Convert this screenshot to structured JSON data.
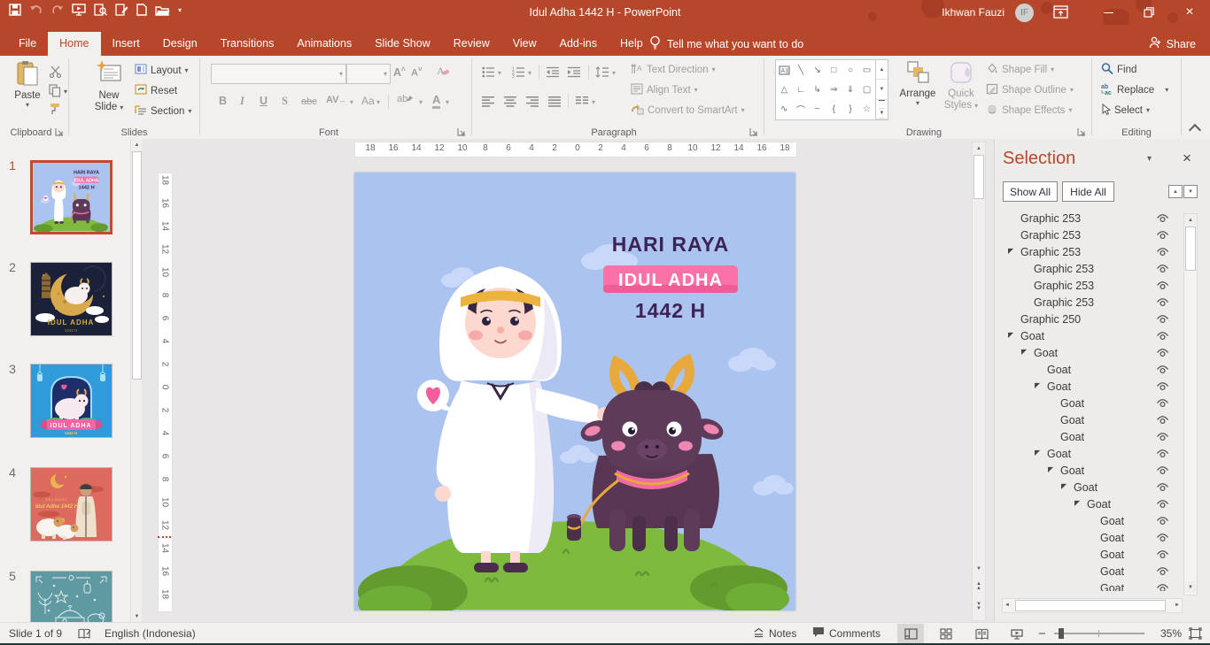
{
  "titlebar": {
    "title": "Idul Adha 1442 H  -  PowerPoint",
    "user": "Ikhwan Fauzi",
    "initials": "IF"
  },
  "tabs": {
    "items": [
      "File",
      "Home",
      "Insert",
      "Design",
      "Transitions",
      "Animations",
      "Slide Show",
      "Review",
      "View",
      "Add-ins",
      "Help"
    ],
    "active": "Home",
    "tell_me": "Tell me what you want to do",
    "share": "Share"
  },
  "ribbon": {
    "clipboard": {
      "title": "Clipboard",
      "paste": "Paste"
    },
    "slides": {
      "title": "Slides",
      "new_line1": "New",
      "new_line2": "Slide",
      "layout": "Layout",
      "reset": "Reset",
      "section": "Section"
    },
    "font": {
      "title": "Font",
      "bold": "B",
      "italic": "I",
      "underline": "U",
      "strikethrough": "S",
      "abc": "abc",
      "spacing": "AV",
      "case": "Aa",
      "highlight": "ab",
      "color": "A",
      "grow": "A",
      "shrink": "A"
    },
    "paragraph": {
      "title": "Paragraph",
      "text_direction": "Text Direction",
      "align_text": "Align Text",
      "smartart": "Convert to SmartArt"
    },
    "drawing": {
      "title": "Drawing",
      "arrange": "Arrange",
      "quick1": "Quick",
      "quick2": "Styles",
      "shape_fill": "Shape Fill",
      "shape_outline": "Shape Outline",
      "shape_effects": "Shape Effects",
      "shape_glyphs": [
        "╲",
        "↘",
        "□",
        "○",
        "▭",
        "△",
        "∟",
        "↳",
        "⇒",
        "⇓",
        "▢",
        "∿",
        "⌒",
        "~",
        "{",
        "}",
        "☆"
      ]
    },
    "editing": {
      "title": "Editing",
      "find": "Find",
      "replace": "Replace",
      "select": "Select"
    }
  },
  "rulers": {
    "h": [
      "18",
      "16",
      "14",
      "12",
      "10",
      "8",
      "6",
      "4",
      "2",
      "0",
      "2",
      "4",
      "6",
      "8",
      "10",
      "12",
      "14",
      "16",
      "18"
    ],
    "v": [
      "18",
      "16",
      "14",
      "12",
      "10",
      "8",
      "6",
      "4",
      "2",
      "0",
      "2",
      "4",
      "6",
      "8",
      "10",
      "12",
      "14",
      "16",
      "18"
    ]
  },
  "slide": {
    "heading": "HARI RAYA",
    "banner": "IDUL ADHA",
    "year": "1442 H"
  },
  "thumbnails": {
    "items": [
      {
        "number": "1"
      },
      {
        "number": "2"
      },
      {
        "number": "3"
      },
      {
        "number": "4"
      },
      {
        "number": "5"
      }
    ],
    "captions": {
      "t2_title": "IDUL ADHA",
      "t2_year": "1442 H",
      "t3_title": "IDUL ADHA",
      "t3_year": "1442 H",
      "t4_small": "SELAMAT",
      "t4_title": "Idul Adha 1442 H"
    }
  },
  "selection_pane": {
    "title": "Selection",
    "show_all": "Show All",
    "hide_all": "Hide All",
    "items": [
      {
        "label": "Graphic 253",
        "level": 1,
        "expanded": false
      },
      {
        "label": "Graphic 253",
        "level": 1,
        "expanded": false
      },
      {
        "label": "Graphic 253",
        "level": 1,
        "expanded": true
      },
      {
        "label": "Graphic 253",
        "level": 2,
        "expanded": false
      },
      {
        "label": "Graphic 253",
        "level": 2,
        "expanded": false
      },
      {
        "label": "Graphic 253",
        "level": 2,
        "expanded": false
      },
      {
        "label": "Graphic 250",
        "level": 1,
        "expanded": false
      },
      {
        "label": "Goat",
        "level": 1,
        "expanded": true
      },
      {
        "label": "Goat",
        "level": 2,
        "expanded": true
      },
      {
        "label": "Goat",
        "level": 3,
        "expanded": false
      },
      {
        "label": "Goat",
        "level": 3,
        "expanded": true
      },
      {
        "label": "Goat",
        "level": 4,
        "expanded": false
      },
      {
        "label": "Goat",
        "level": 4,
        "expanded": false
      },
      {
        "label": "Goat",
        "level": 4,
        "expanded": false
      },
      {
        "label": "Goat",
        "level": 3,
        "expanded": true
      },
      {
        "label": "Goat",
        "level": 4,
        "expanded": true
      },
      {
        "label": "Goat",
        "level": 5,
        "expanded": true
      },
      {
        "label": "Goat",
        "level": 6,
        "expanded": true
      },
      {
        "label": "Goat",
        "level": 7,
        "expanded": false
      },
      {
        "label": "Goat",
        "level": 7,
        "expanded": false
      },
      {
        "label": "Goat",
        "level": 7,
        "expanded": false
      },
      {
        "label": "Goat",
        "level": 7,
        "expanded": false
      },
      {
        "label": "Goat",
        "level": 7,
        "expanded": false
      }
    ]
  },
  "statusbar": {
    "slide_info": "Slide 1 of 9",
    "language": "English (Indonesia)",
    "notes": "Notes",
    "comments": "Comments",
    "zoom_level": "35%"
  },
  "icons": {
    "chevron_down": "▾",
    "caret_expanded": "◤",
    "close": "×",
    "up": "▲",
    "down": "▼",
    "left": "◄",
    "right": "►",
    "minimize": "─",
    "lightbulb": "lightbulb",
    "search": "search"
  },
  "colors": {
    "accent_red": "#b7472a",
    "slide_bg": "#abc3ef",
    "banner_pink": "#fa71a8",
    "title_purple": "#3d2356",
    "hill_green": "#7eba3e",
    "goat_plum": "#5e3b58"
  }
}
